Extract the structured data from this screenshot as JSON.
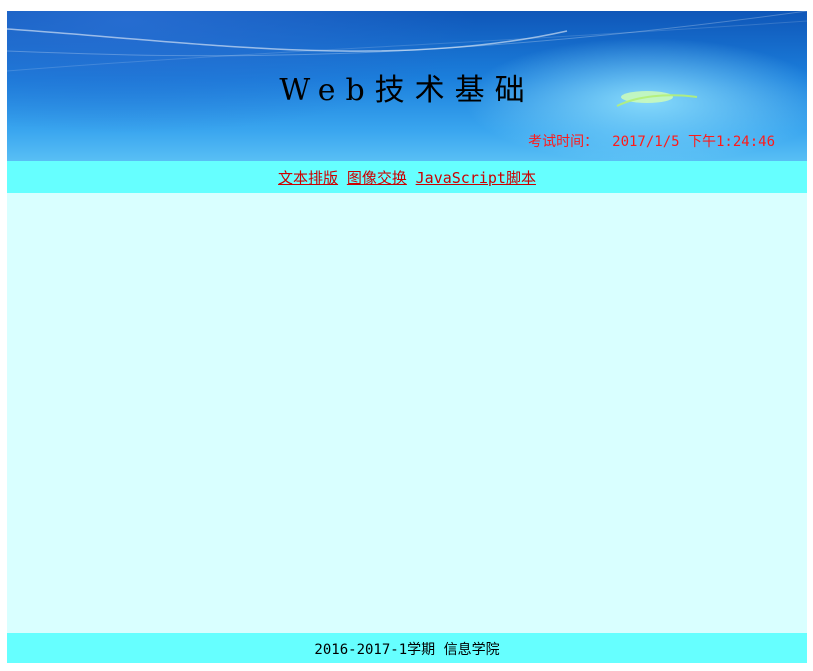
{
  "header": {
    "title": "Web技术基础",
    "exam_time_label": "考试时间：",
    "exam_time_value": "2017/1/5 下午1:24:46"
  },
  "nav": {
    "links": [
      {
        "label": "文本排版"
      },
      {
        "label": "图像交换"
      },
      {
        "label": "JavaScript脚本"
      }
    ]
  },
  "footer": {
    "text": "2016-2017-1学期 信息学院"
  },
  "colors": {
    "nav_bg": "#66ffff",
    "content_bg": "#d9ffff",
    "exam_time": "#ff1a1a",
    "link": "#cc0000"
  }
}
